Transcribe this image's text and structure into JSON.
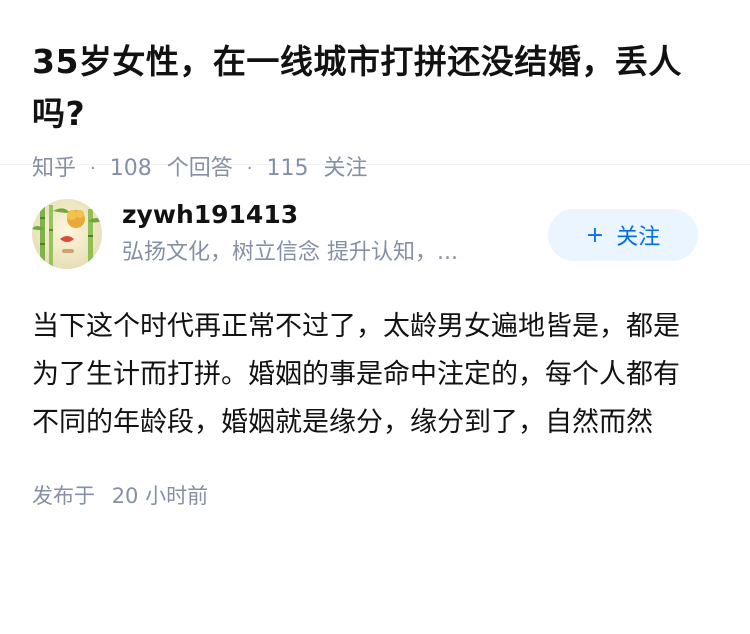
{
  "question": {
    "title": "35岁女性，在一线城市打拼还没结婚，丢人吗?",
    "source": "知乎",
    "answers_count": "108",
    "answers_label": "个回答",
    "followers_count": "115",
    "followers_label": "关注",
    "separator": "·"
  },
  "answer": {
    "author": {
      "name": "zywh191413",
      "bio": "弘扬文化，树立信念 提升认知，...",
      "avatar_icon": "bamboo-avatar-icon"
    },
    "follow_button": {
      "icon": "+",
      "label": "关注"
    },
    "content": "当下这个时代再正常不过了，太龄男女遍地皆是，都是为了生计而打拼。婚姻的事是命中注定的，每个人都有不同的年龄段，婚姻就是缘分，缘分到了，自然而然",
    "publish": {
      "label": "发布于",
      "time": "20 小时前"
    }
  },
  "colors": {
    "text": "#121212",
    "meta": "#8590a6",
    "accent": "#056de8",
    "button_bg": "#ebf5ff"
  }
}
